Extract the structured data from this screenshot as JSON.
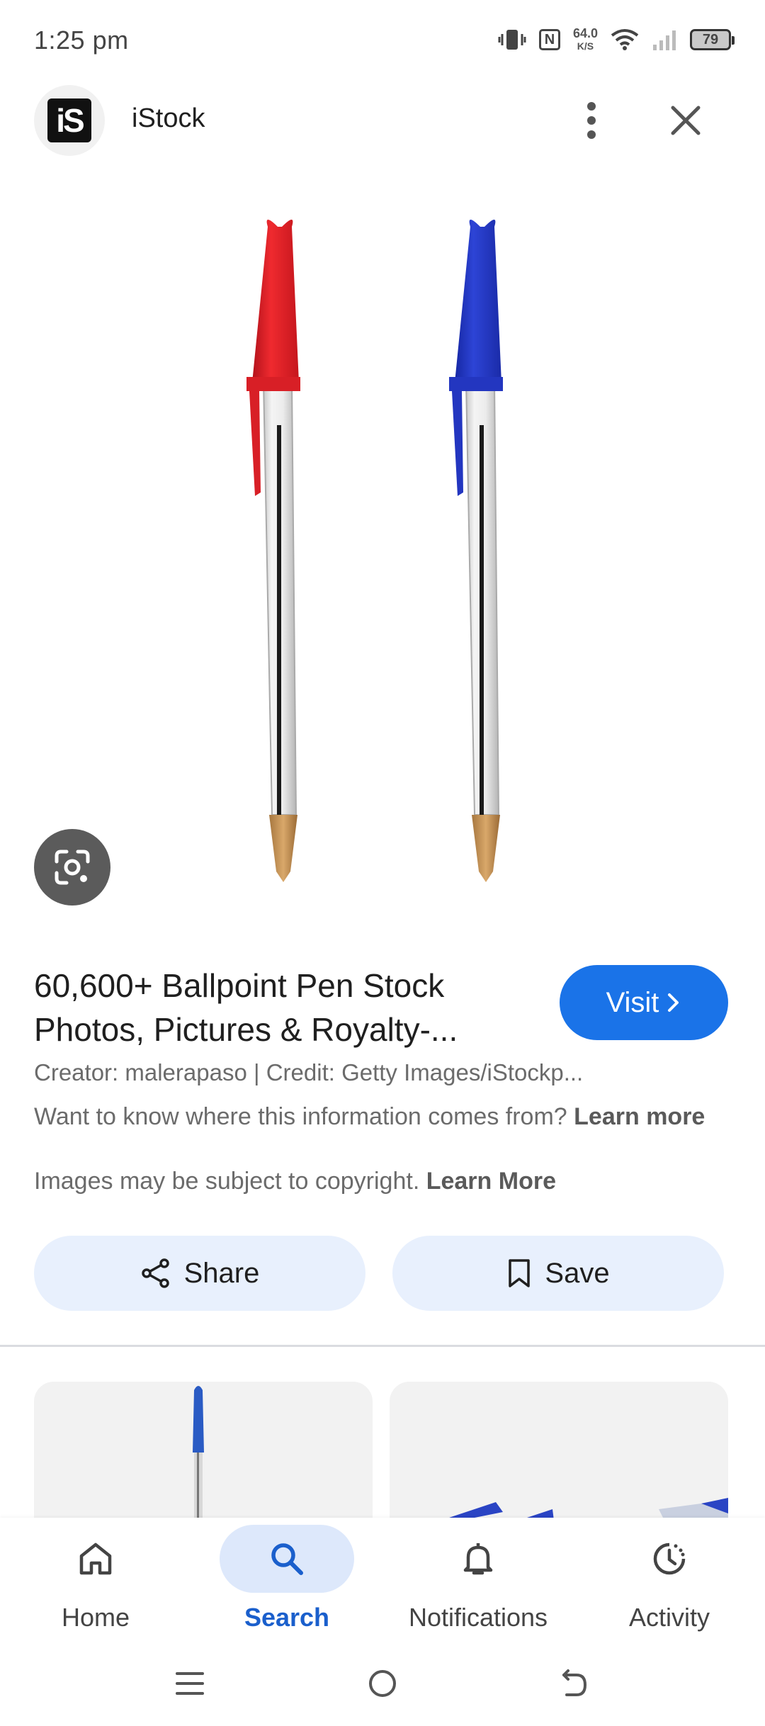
{
  "status_bar": {
    "time": "1:25 pm",
    "net_speed": "64.0",
    "net_speed_unit": "K/S",
    "battery": "79",
    "nfc_label": "N"
  },
  "header": {
    "site_name": "iStock",
    "logo_text": "iS"
  },
  "result": {
    "title": "60,600+ Ballpoint Pen Stock Photos, Pictures & Royalty-...",
    "visit_label": "Visit",
    "creator_line": "Creator: malerapaso | Credit: Getty Images/iStockp...",
    "info_text": "Want to know where this information comes from?",
    "info_link": "Learn more",
    "copyright_text": "Images may be subject to copyright.",
    "copyright_link": "Learn More",
    "share_label": "Share",
    "save_label": "Save"
  },
  "colors": {
    "accent": "#1a73e8",
    "action_button_bg": "#e8f0fd",
    "active_nav_bg": "#dde8fb"
  },
  "bottom_nav": {
    "items": [
      {
        "label": "Home",
        "icon": "home-icon",
        "active": false
      },
      {
        "label": "Search",
        "icon": "search-icon",
        "active": true
      },
      {
        "label": "Notifications",
        "icon": "bell-icon",
        "active": false
      },
      {
        "label": "Activity",
        "icon": "history-icon",
        "active": false
      }
    ]
  }
}
